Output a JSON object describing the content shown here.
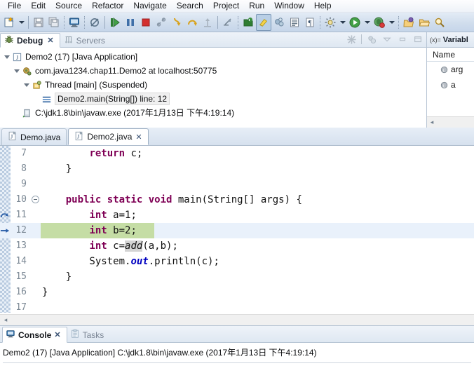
{
  "menubar": {
    "items": [
      {
        "label": "File"
      },
      {
        "label": "Edit"
      },
      {
        "label": "Source"
      },
      {
        "label": "Refactor"
      },
      {
        "label": "Navigate"
      },
      {
        "label": "Search"
      },
      {
        "label": "Project"
      },
      {
        "label": "Run"
      },
      {
        "label": "Window"
      },
      {
        "label": "Help"
      }
    ]
  },
  "toolbar": {
    "items": [
      {
        "name": "new-wizard-icon",
        "title": "New"
      },
      {
        "name": "new-dropdown-icon",
        "title": "New dropdown"
      },
      {
        "name": "save-icon",
        "title": "Save"
      },
      {
        "name": "save-all-icon",
        "title": "Save All"
      },
      {
        "name": "open-console-icon",
        "title": "Open Console"
      },
      {
        "name": "skip-breakpoints-icon",
        "title": "Skip All Breakpoints"
      },
      {
        "name": "resume-icon",
        "title": "Resume"
      },
      {
        "name": "suspend-icon",
        "title": "Suspend"
      },
      {
        "name": "terminate-icon",
        "title": "Terminate"
      },
      {
        "name": "disconnect-icon",
        "title": "Disconnect"
      },
      {
        "name": "step-into-icon",
        "title": "Step Into"
      },
      {
        "name": "step-over-icon",
        "title": "Step Over"
      },
      {
        "name": "step-return-icon",
        "title": "Step Return"
      },
      {
        "name": "drop-to-frame-icon",
        "title": "Drop to Frame"
      },
      {
        "name": "use-step-filters-icon",
        "title": "Use Step Filters"
      },
      {
        "name": "new-java-project-icon",
        "title": "New Java Project"
      },
      {
        "name": "new-java-class-icon",
        "title": "New Java Class"
      },
      {
        "name": "debug-perspective-icon",
        "title": "Debug"
      },
      {
        "name": "coverage-icon",
        "title": "Coverage"
      },
      {
        "name": "open-type-icon",
        "title": "Open Type"
      },
      {
        "name": "toggle-mark-occurrences-icon",
        "title": "Toggle Mark Occurrences"
      },
      {
        "name": "external-tools-icon",
        "title": "External Tools"
      },
      {
        "name": "external-tools-dropdown-icon",
        "title": "External Tools dropdown"
      },
      {
        "name": "run-icon",
        "title": "Run"
      },
      {
        "name": "run-dropdown-icon",
        "title": "Run dropdown"
      },
      {
        "name": "debug-icon",
        "title": "Debug"
      },
      {
        "name": "debug-dropdown-icon",
        "title": "Debug dropdown"
      },
      {
        "name": "open-task-icon",
        "title": "Open Task"
      },
      {
        "name": "open-folder-icon",
        "title": "Open Folder"
      },
      {
        "name": "search-icon",
        "title": "Search"
      }
    ]
  },
  "debug_view": {
    "tabs": [
      {
        "label": "Debug",
        "icon": "bug-icon",
        "active": true,
        "closable": true
      },
      {
        "label": "Servers",
        "icon": "servers-icon",
        "active": false,
        "closable": false
      }
    ],
    "toolbar": [
      {
        "name": "remove-all-terminated-icon"
      },
      {
        "name": "link-debug-view-icon"
      },
      {
        "name": "view-menu-icon"
      },
      {
        "name": "minimize-icon"
      },
      {
        "name": "maximize-icon"
      }
    ],
    "tree": [
      {
        "indent": 0,
        "twisty": "expanded",
        "icon": "java-launch-icon",
        "label": "Demo2 (17) [Java Application]",
        "selected": false
      },
      {
        "indent": 1,
        "twisty": "expanded",
        "icon": "debug-target-icon",
        "label": "com.java1234.chap11.Demo2 at localhost:50775",
        "selected": false
      },
      {
        "indent": 2,
        "twisty": "expanded",
        "icon": "thread-icon",
        "label": "Thread [main] (Suspended)",
        "selected": false
      },
      {
        "indent": 3,
        "twisty": "none",
        "icon": "stack-frame-icon",
        "label": "Demo2.main(String[]) line: 12",
        "selected": true
      },
      {
        "indent": 1,
        "twisty": "none",
        "icon": "process-icon",
        "label": "C:\\jdk1.8\\bin\\javaw.exe (2017年1月13日 下午4:19:14)",
        "selected": false
      }
    ]
  },
  "variables_view": {
    "tab_label": "Variabl",
    "tab_prefix": "(x)=",
    "column_header": "Name",
    "rows": [
      {
        "icon": "local-variable-icon",
        "name": "arg"
      },
      {
        "icon": "local-variable-icon",
        "name": "a"
      }
    ],
    "scroll_left_glyph": "◂"
  },
  "editor": {
    "tabs": [
      {
        "label": "Demo.java",
        "icon": "java-file-icon",
        "active": false,
        "closable": false
      },
      {
        "label": "Demo2.java",
        "icon": "java-file-icon",
        "active": true,
        "closable": true
      }
    ],
    "scroll_left_glyph": "◂",
    "lines": [
      {
        "number": "7",
        "fold": false,
        "marker": "none",
        "highlight": "none",
        "tokens": [
          {
            "t": "        ",
            "c": "p"
          },
          {
            "t": "return",
            "c": "kw"
          },
          {
            "t": " c;",
            "c": "p"
          }
        ]
      },
      {
        "number": "8",
        "fold": false,
        "marker": "none",
        "highlight": "none",
        "tokens": [
          {
            "t": "    }",
            "c": "p"
          }
        ]
      },
      {
        "number": "9",
        "fold": false,
        "marker": "none",
        "highlight": "none",
        "tokens": [
          {
            "t": "",
            "c": "p"
          }
        ]
      },
      {
        "number": "10",
        "fold": true,
        "marker": "none",
        "highlight": "none",
        "tokens": [
          {
            "t": "    ",
            "c": "p"
          },
          {
            "t": "public static void",
            "c": "kw"
          },
          {
            "t": " main(String[] args) {",
            "c": "p"
          }
        ]
      },
      {
        "number": "11",
        "fold": false,
        "marker": "step",
        "highlight": "none",
        "tokens": [
          {
            "t": "        ",
            "c": "p"
          },
          {
            "t": "int",
            "c": "kw"
          },
          {
            "t": " a=1;",
            "c": "p"
          }
        ]
      },
      {
        "number": "12",
        "fold": false,
        "marker": "arrow",
        "highlight": "current",
        "green_width": 162,
        "tokens": [
          {
            "t": "        ",
            "c": "p"
          },
          {
            "t": "int",
            "c": "kw"
          },
          {
            "t": " b=2;",
            "c": "p"
          }
        ]
      },
      {
        "number": "13",
        "fold": false,
        "marker": "none",
        "highlight": "none",
        "tokens": [
          {
            "t": "        ",
            "c": "p"
          },
          {
            "t": "int",
            "c": "kw"
          },
          {
            "t": " c=",
            "c": "p"
          },
          {
            "t": "add",
            "c": "mcall"
          },
          {
            "t": "(a,b);",
            "c": "p"
          }
        ]
      },
      {
        "number": "14",
        "fold": false,
        "marker": "none",
        "highlight": "none",
        "tokens": [
          {
            "t": "        System.",
            "c": "p"
          },
          {
            "t": "out",
            "c": "sfield"
          },
          {
            "t": ".println(c);",
            "c": "p"
          }
        ]
      },
      {
        "number": "15",
        "fold": false,
        "marker": "none",
        "highlight": "none",
        "tokens": [
          {
            "t": "    }",
            "c": "p"
          }
        ]
      },
      {
        "number": "16",
        "fold": false,
        "marker": "none",
        "highlight": "none",
        "tokens": [
          {
            "t": "}",
            "c": "p"
          }
        ]
      },
      {
        "number": "17",
        "fold": false,
        "marker": "none",
        "highlight": "none",
        "tokens": [
          {
            "t": "",
            "c": "p"
          }
        ]
      }
    ]
  },
  "console": {
    "tabs": [
      {
        "label": "Console",
        "icon": "console-icon",
        "active": true,
        "closable": true
      },
      {
        "label": "Tasks",
        "icon": "tasks-icon",
        "active": false,
        "closable": false
      }
    ],
    "header_line": "Demo2 (17) [Java Application] C:\\jdk1.8\\bin\\javaw.exe (2017年1月13日 下午4:19:14)"
  },
  "colors": {
    "keyword": "#7f0055",
    "static_field": "#0000c0",
    "current_line": "#e9f1fb",
    "debug_highlight": "#c5dda5",
    "toolbar_bg": "#cfdcec",
    "tab_bg": "#dfe8f2"
  }
}
